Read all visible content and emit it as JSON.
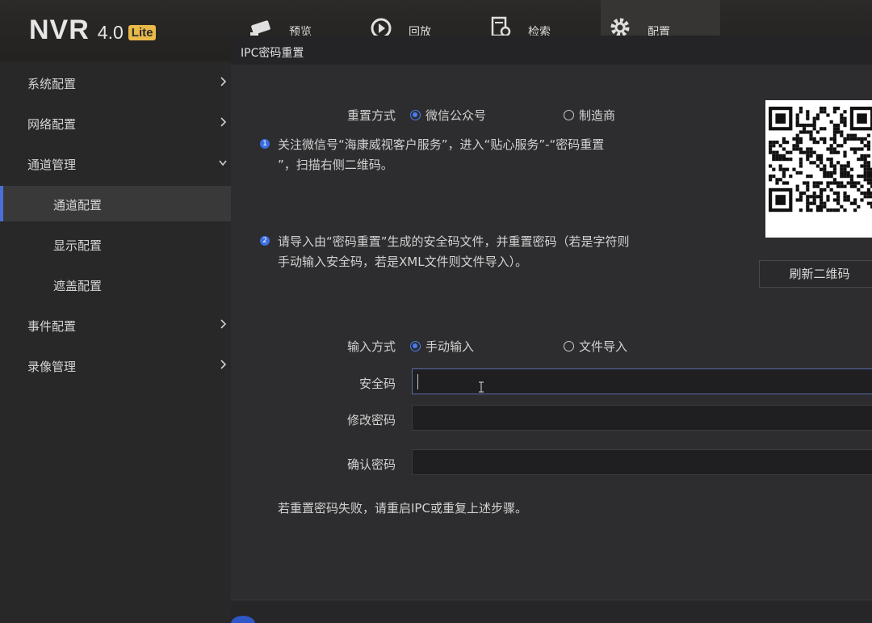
{
  "logo": {
    "name": "NVR",
    "version": "4.0",
    "badge": "Lite"
  },
  "nav": [
    {
      "label": "预览",
      "icon": "preview-icon"
    },
    {
      "label": "回放",
      "icon": "playback-icon"
    },
    {
      "label": "检索",
      "icon": "search-icon"
    },
    {
      "label": "配置",
      "icon": "gear-icon",
      "active": true
    }
  ],
  "sidebar": {
    "items": [
      {
        "label": "系统配置"
      },
      {
        "label": "网络配置"
      },
      {
        "label": "通道管理",
        "expanded": true
      },
      {
        "label": "通道配置",
        "active": true
      },
      {
        "label": "显示配置"
      },
      {
        "label": "遮盖配置"
      },
      {
        "label": "事件配置"
      },
      {
        "label": "录像管理"
      }
    ]
  },
  "dialog": {
    "title": "IPC密码重置",
    "reset_method": {
      "label": "重置方式",
      "options": [
        "微信公众号",
        "制造商"
      ],
      "selected": "微信公众号"
    },
    "step1_line1": "关注微信号“海康威视客户服务”，进入“贴心服务”-“密码重置",
    "step1_line2": "”，扫描右侧二维码。",
    "step1_num": "1",
    "step2_line1": "请导入由“密码重置”生成的安全码文件，并重置密码（若是字符则",
    "step2_line2": "手动输入安全码，若是XML文件则文件导入）。",
    "step2_num": "2",
    "refresh_button": "刷新二维码",
    "input_method": {
      "label": "输入方式",
      "options": [
        "手动输入",
        "文件导入"
      ],
      "selected": "手动输入"
    },
    "security_code": {
      "label": "安全码",
      "value": ""
    },
    "new_password": {
      "label": "修改密码",
      "value": ""
    },
    "confirm_password": {
      "label": "确认密码",
      "value": ""
    },
    "note": "若重置密码失败，请重启IPC或重复上述步骤。"
  },
  "colors": {
    "accent": "#4a7cf0",
    "lite_badge": "#e9b949",
    "sidebar_active": "#4a6fd6"
  }
}
